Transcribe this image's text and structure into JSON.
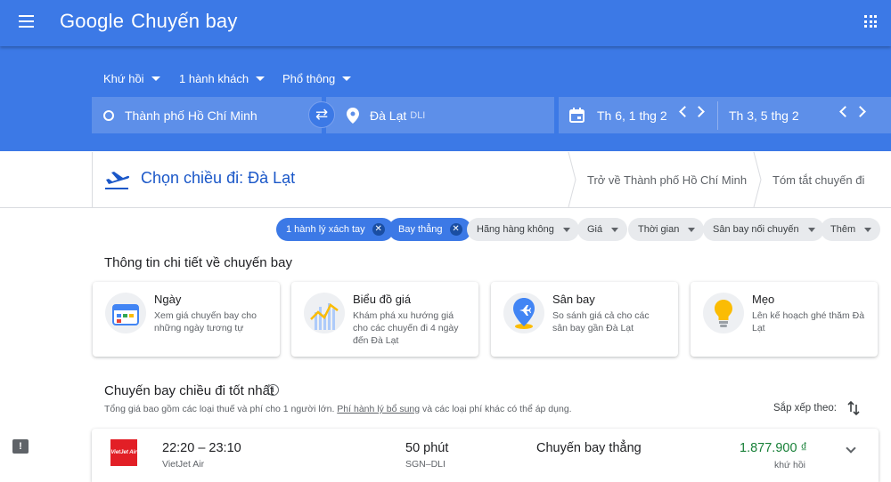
{
  "app": {
    "logo": "Google",
    "product": "Chuyến bay"
  },
  "search": {
    "trip_type": "Khứ hồi",
    "passengers": "1 hành khách",
    "cabin": "Phổ thông",
    "origin": "Thành phố Hồ Chí Minh",
    "destination": "Đà Lạt",
    "destination_code": "DLI",
    "depart_date": "Th 6, 1 thg 2",
    "return_date": "Th 3, 5 thg 2"
  },
  "steps": {
    "title": "Chọn chiều đi: Đà Lạt",
    "return": "Trở về Thành phố Hồ Chí Minh",
    "summary": "Tóm tắt chuyến đi"
  },
  "filters": {
    "active": [
      {
        "label": "1 hành lý xách tay",
        "remove": "✕"
      },
      {
        "label": "Bay thẳng",
        "remove": "✕"
      }
    ],
    "dropdowns": [
      "Hãng hàng không",
      "Giá",
      "Thời gian",
      "Sân bay nối chuyến",
      "Thêm"
    ]
  },
  "insights": {
    "title": "Thông tin chi tiết về chuyến bay",
    "cards": [
      {
        "title": "Ngày",
        "desc": [
          "Xem giá chuyến bay cho",
          "những ngày tương tự"
        ],
        "icon": "calendar-icon"
      },
      {
        "title": "Biểu đồ giá",
        "desc": [
          "Khám phá xu hướng giá",
          "cho các chuyến đi 4 ngày",
          "đến Đà Lạt"
        ],
        "icon": "price-graph-icon"
      },
      {
        "title": "Sân bay",
        "desc": [
          "So sánh giá cả cho các",
          "sân bay gần Đà Lạt"
        ],
        "icon": "airport-pin-icon"
      },
      {
        "title": "Mẹo",
        "desc": [
          "Lên kế hoạch ghé thăm Đà",
          "Lạt"
        ],
        "icon": "lightbulb-icon"
      }
    ]
  },
  "results": {
    "title": "Chuyến bay chiều đi tốt nhất",
    "note_prefix": "Tổng giá bao gồm các loại thuế và phí cho 1 người lớn. ",
    "note_link": "Phí hành lý bổ sung",
    "note_suffix": " và các loại phí khác có thể áp dụng.",
    "sort_label": "Sắp xếp theo:",
    "flights": [
      {
        "logo_text": "VietJet Air",
        "times": "22:20 – 23:10",
        "airline": "VietJet Air",
        "duration": "50 phút",
        "route": "SGN–DLI",
        "stops": "Chuyến bay thẳng",
        "price": "1.877.900 ₫",
        "price_type": "khứ hồi"
      }
    ]
  },
  "colors": {
    "header": "#3c79e6",
    "price": "#188038",
    "title": "#1a57c8"
  }
}
